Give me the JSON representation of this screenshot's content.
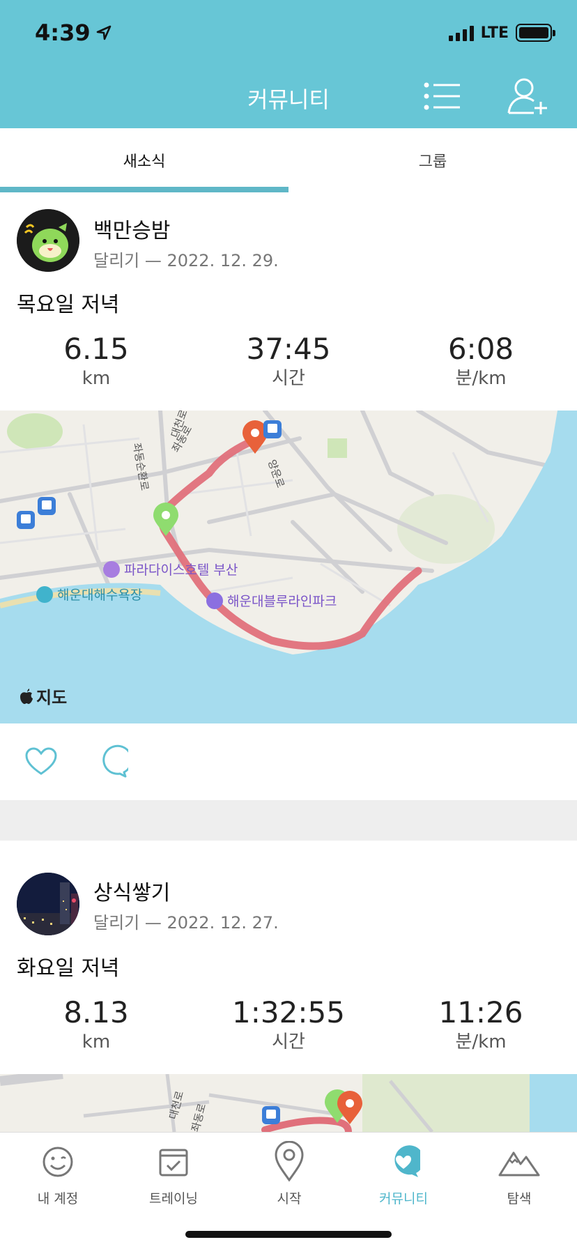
{
  "status_bar": {
    "time": "4:39",
    "network": "LTE"
  },
  "header": {
    "title": "커뮤니티"
  },
  "tabs": [
    {
      "label": "새소식",
      "active": true
    },
    {
      "label": "그룹",
      "active": false
    }
  ],
  "posts": [
    {
      "username": "백만승밤",
      "meta": "달리기 — 2022. 12. 29.",
      "title": "목요일 저녁",
      "stats": [
        {
          "value": "6.15",
          "unit": "km"
        },
        {
          "value": "37:45",
          "unit": "시간"
        },
        {
          "value": "6:08",
          "unit": "분/km"
        }
      ],
      "map": {
        "labels": [
          "파라다이스호텔 부산",
          "해운대해수욕장",
          "해운대블루라인파크",
          "좌동순환로",
          "좌동로",
          "대천로",
          "양운로"
        ],
        "credit": "지도"
      }
    },
    {
      "username": "상식쌓기",
      "meta": "달리기 — 2022. 12. 27.",
      "title": "화요일 저녁",
      "stats": [
        {
          "value": "8.13",
          "unit": "km"
        },
        {
          "value": "1:32:55",
          "unit": "시간"
        },
        {
          "value": "11:26",
          "unit": "분/km"
        }
      ],
      "map": {
        "labels": [
          "대천로",
          "좌동로"
        ]
      }
    }
  ],
  "bottom_nav": [
    {
      "label": "내 계정",
      "icon": "smiley-icon",
      "active": false
    },
    {
      "label": "트레이닝",
      "icon": "calendar-check-icon",
      "active": false
    },
    {
      "label": "시작",
      "icon": "location-pin-icon",
      "active": false
    },
    {
      "label": "커뮤니티",
      "icon": "community-heart-bubble-icon",
      "active": true
    },
    {
      "label": "탐색",
      "icon": "mountain-icon",
      "active": false
    }
  ],
  "colors": {
    "header": "#67c6d6",
    "accent": "#4fb6cb",
    "route": "#e0707b",
    "water": "#a6dcee",
    "start_pin": "#8fdc6f",
    "end_pin": "#e8613a"
  }
}
